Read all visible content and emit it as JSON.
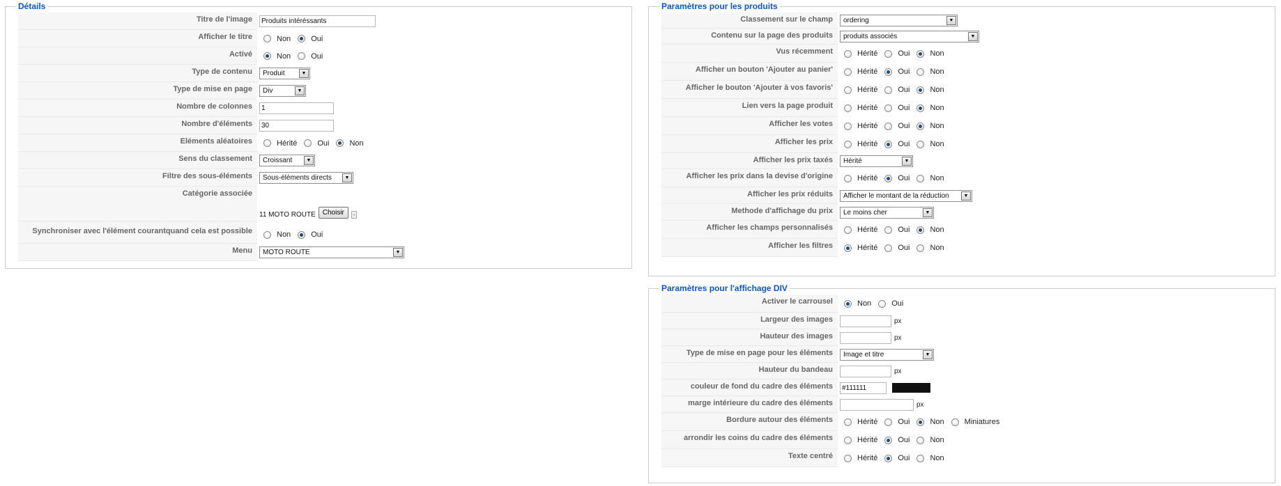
{
  "details": {
    "legend": "Détails",
    "titre_image": {
      "label": "Titre de l'image",
      "value": "Produits intéréssants"
    },
    "afficher_titre": {
      "label": "Afficher le titre",
      "options": [
        "Non",
        "Oui"
      ],
      "selected": "Oui"
    },
    "active": {
      "label": "Activé",
      "options": [
        "Non",
        "Oui"
      ],
      "selected": "Non"
    },
    "type_contenu": {
      "label": "Type de contenu",
      "value": "Produit"
    },
    "type_mise_en_page": {
      "label": "Type de mise en page",
      "value": "Div"
    },
    "nb_colonnes": {
      "label": "Nombre de colonnes",
      "value": "1"
    },
    "nb_elements": {
      "label": "Nombre d'éléments",
      "value": "30"
    },
    "elements_aleatoires": {
      "label": "Eléments aléatoires",
      "options": [
        "Hérité",
        "Oui",
        "Non"
      ],
      "selected": "Non"
    },
    "sens_classement": {
      "label": "Sens du classement",
      "value": "Croissant"
    },
    "filtre_sous_elements": {
      "label": "Filtre des sous-éléments",
      "value": "Sous-éléments directs"
    },
    "categorie_associee": {
      "label": "Catégorie associée",
      "value": "11 MOTO ROUTE",
      "button": "Choisir"
    },
    "synchroniser": {
      "label": "Synchroniser avec l'élément courantquand cela est possible",
      "options": [
        "Non",
        "Oui"
      ],
      "selected": "Oui"
    },
    "menu": {
      "label": "Menu",
      "value": "MOTO ROUTE"
    }
  },
  "produits": {
    "legend": "Paramètres pour les produits",
    "classement_champ": {
      "label": "Classement sur le champ",
      "value": "ordering"
    },
    "contenu_page": {
      "label": "Contenu sur la page des produits",
      "value": "produits associés"
    },
    "vus_recemment": {
      "label": "Vus récemment",
      "options": [
        "Hérité",
        "Oui",
        "Non"
      ],
      "selected": "Non"
    },
    "bouton_panier": {
      "label": "Afficher un bouton 'Ajouter au panier'",
      "options": [
        "Hérité",
        "Oui",
        "Non"
      ],
      "selected": "Oui"
    },
    "bouton_favoris": {
      "label": "Afficher le bouton 'Ajouter à vos favoris'",
      "options": [
        "Hérité",
        "Oui",
        "Non"
      ],
      "selected": "Non"
    },
    "lien_page_produit": {
      "label": "Lien vers la page produit",
      "options": [
        "Hérité",
        "Oui",
        "Non"
      ],
      "selected": "Non"
    },
    "afficher_votes": {
      "label": "Afficher les votes",
      "options": [
        "Hérité",
        "Oui",
        "Non"
      ],
      "selected": "Non"
    },
    "afficher_prix": {
      "label": "Afficher les prix",
      "options": [
        "Hérité",
        "Oui",
        "Non"
      ],
      "selected": "Oui"
    },
    "prix_taxes": {
      "label": "Afficher les prix taxés",
      "value": "Hérité"
    },
    "prix_devise": {
      "label": "Afficher les prix dans la devise d'origine",
      "options": [
        "Hérité",
        "Oui",
        "Non"
      ],
      "selected": "Oui"
    },
    "prix_reduits": {
      "label": "Afficher les prix réduits",
      "value": "Afficher le montant de la réduction"
    },
    "methode_prix": {
      "label": "Methode d'affichage du prix",
      "value": "Le moins cher"
    },
    "champs_perso": {
      "label": "Afficher les champs personnalisés",
      "options": [
        "Hérité",
        "Oui",
        "Non"
      ],
      "selected": "Non"
    },
    "filtres": {
      "label": "Afficher les filtres",
      "options": [
        "Hérité",
        "Oui",
        "Non"
      ],
      "selected": "Hérité"
    }
  },
  "div": {
    "legend": "Paramètres pour l'affichage DIV",
    "carrousel": {
      "label": "Activer le carrousel",
      "options": [
        "Non",
        "Oui"
      ],
      "selected": "Non"
    },
    "largeur_images": {
      "label": "Largeur des images",
      "value": "",
      "unit": "px"
    },
    "hauteur_images": {
      "label": "Hauteur des images",
      "value": "",
      "unit": "px"
    },
    "type_mise_en_page_elements": {
      "label": "Type de mise en page pour les éléments",
      "value": "Image et titre"
    },
    "hauteur_bandeau": {
      "label": "Hauteur du bandeau",
      "value": "",
      "unit": "px"
    },
    "couleur_fond": {
      "label": "couleur de fond du cadre des éléments",
      "value": "#111111",
      "color": "#111111"
    },
    "marge_interieure": {
      "label": "marge intérieure du cadre des éléments",
      "value": "",
      "unit": "px"
    },
    "bordure": {
      "label": "Bordure autour des éléments",
      "options": [
        "Hérité",
        "Oui",
        "Non",
        "Miniatures"
      ],
      "selected": "Non"
    },
    "arrondir_coins": {
      "label": "arrondir les coins du cadre des éléments",
      "options": [
        "Hérité",
        "Oui",
        "Non"
      ],
      "selected": "Oui"
    },
    "texte_centre": {
      "label": "Texte centré",
      "options": [
        "Hérité",
        "Oui",
        "Non"
      ],
      "selected": "Oui"
    }
  },
  "icons": {
    "dropdown": "chevron-down-icon",
    "category_link": "link-icon"
  },
  "colors": {
    "legend": "#0b55c4",
    "label_bg": "#f6f6f6",
    "swatch": "#111111"
  }
}
